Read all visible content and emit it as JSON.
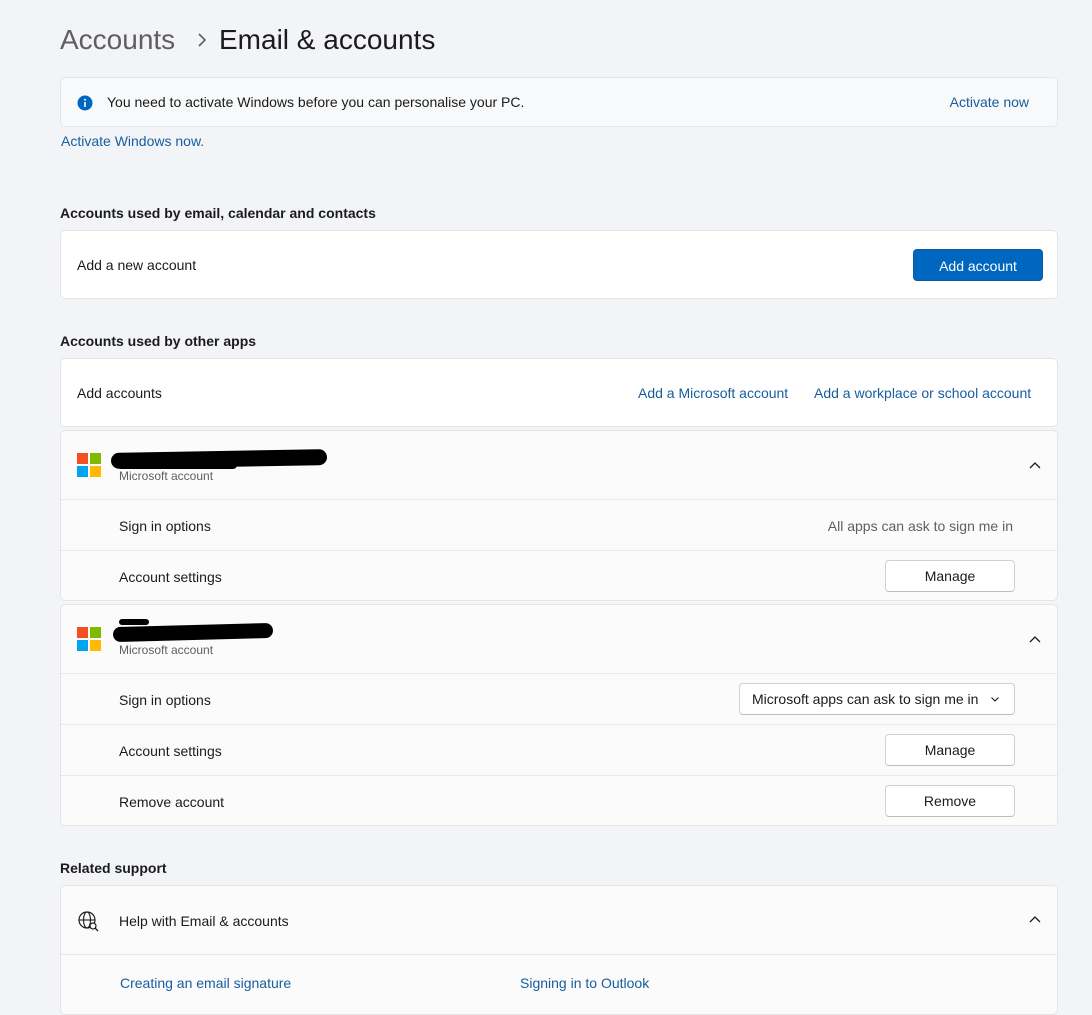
{
  "breadcrumb": {
    "parent": "Accounts",
    "current": "Email & accounts"
  },
  "activation_banner": {
    "message": "You need to activate Windows before you can personalise your PC.",
    "action": "Activate now",
    "link_below": "Activate Windows now."
  },
  "email_section": {
    "title": "Accounts used by email, calendar and contacts",
    "row_label": "Add a new account",
    "button": "Add account"
  },
  "other_apps_section": {
    "title": "Accounts used by other apps",
    "row_label": "Add accounts",
    "link_ms": "Add a Microsoft account",
    "link_work": "Add a workplace or school account"
  },
  "accounts": [
    {
      "type": "Microsoft account",
      "sign_in_label": "Sign in options",
      "sign_in_value": "All apps can ask to sign me in",
      "settings_label": "Account settings",
      "manage_button": "Manage"
    },
    {
      "type": "Microsoft account",
      "sign_in_label": "Sign in options",
      "sign_in_value": "Microsoft apps can ask to sign me in",
      "settings_label": "Account settings",
      "manage_button": "Manage",
      "remove_label": "Remove account",
      "remove_button": "Remove"
    }
  ],
  "related_support": {
    "title": "Related support",
    "help_label": "Help with Email & accounts",
    "links": [
      "Creating an email signature",
      "Signing in to Outlook"
    ]
  },
  "colors": {
    "accent": "#0067c0",
    "link": "#175d9f",
    "info": "#0067c0"
  }
}
